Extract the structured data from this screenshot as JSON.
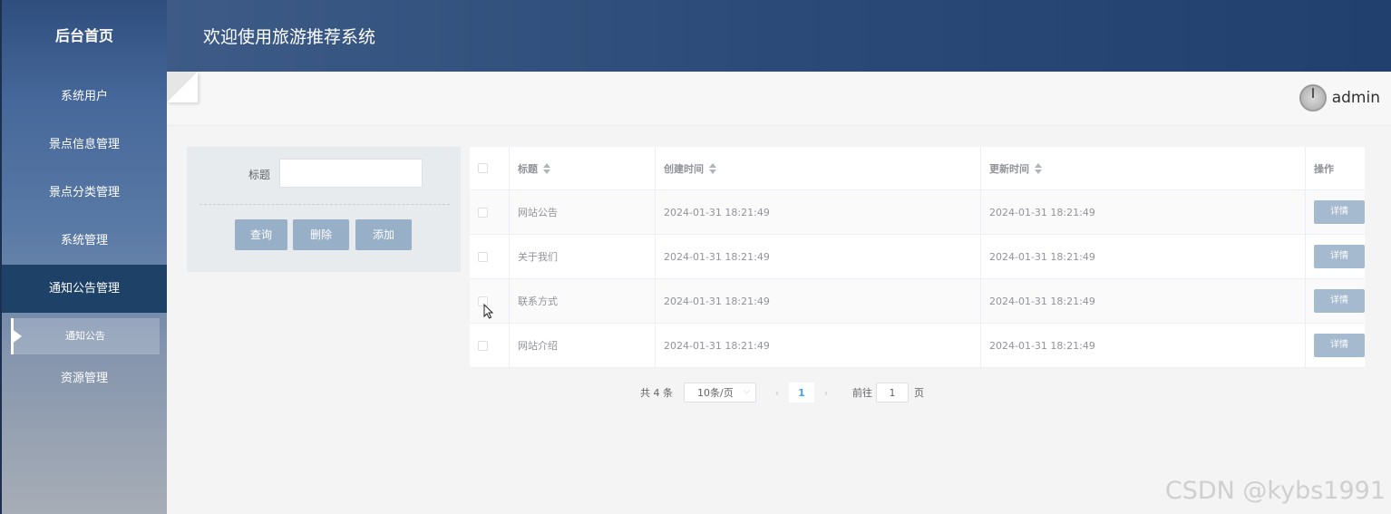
{
  "sidebar": {
    "title": "后台首页",
    "items": [
      {
        "label": "系统用户"
      },
      {
        "label": "景点信息管理"
      },
      {
        "label": "景点分类管理"
      },
      {
        "label": "系统管理"
      },
      {
        "label": "通知公告管理"
      }
    ],
    "subitem": {
      "label": "通知公告"
    },
    "last_item": {
      "label": "资源管理"
    }
  },
  "header": {
    "title": "欢迎使用旅游推荐系统"
  },
  "user": {
    "name": "admin"
  },
  "search": {
    "label": "标题",
    "value": ""
  },
  "buttons": {
    "query": "查询",
    "delete": "删除",
    "add": "添加"
  },
  "table": {
    "columns": {
      "title": "标题",
      "created": "创建时间",
      "updated": "更新时间",
      "op": "操作"
    },
    "rows": [
      {
        "title": "网站公告",
        "created": "2024-01-31 18:21:49",
        "updated": "2024-01-31 18:21:49",
        "op": "详情"
      },
      {
        "title": "关于我们",
        "created": "2024-01-31 18:21:49",
        "updated": "2024-01-31 18:21:49",
        "op": "详情"
      },
      {
        "title": "联系方式",
        "created": "2024-01-31 18:21:49",
        "updated": "2024-01-31 18:21:49",
        "op": "详情"
      },
      {
        "title": "网站介绍",
        "created": "2024-01-31 18:21:49",
        "updated": "2024-01-31 18:21:49",
        "op": "详情"
      }
    ]
  },
  "pagination": {
    "total": "共 4 条",
    "size": "10条/页",
    "prev": "‹",
    "page": "1",
    "next": "›",
    "goto": "前往",
    "goto_value": "1",
    "goto_suffix": "页"
  },
  "watermark": "CSDN @kybs1991",
  "colors": {
    "sidebar_active": "#1e4168",
    "header": "#2c4a78",
    "button": "#98afc8"
  }
}
